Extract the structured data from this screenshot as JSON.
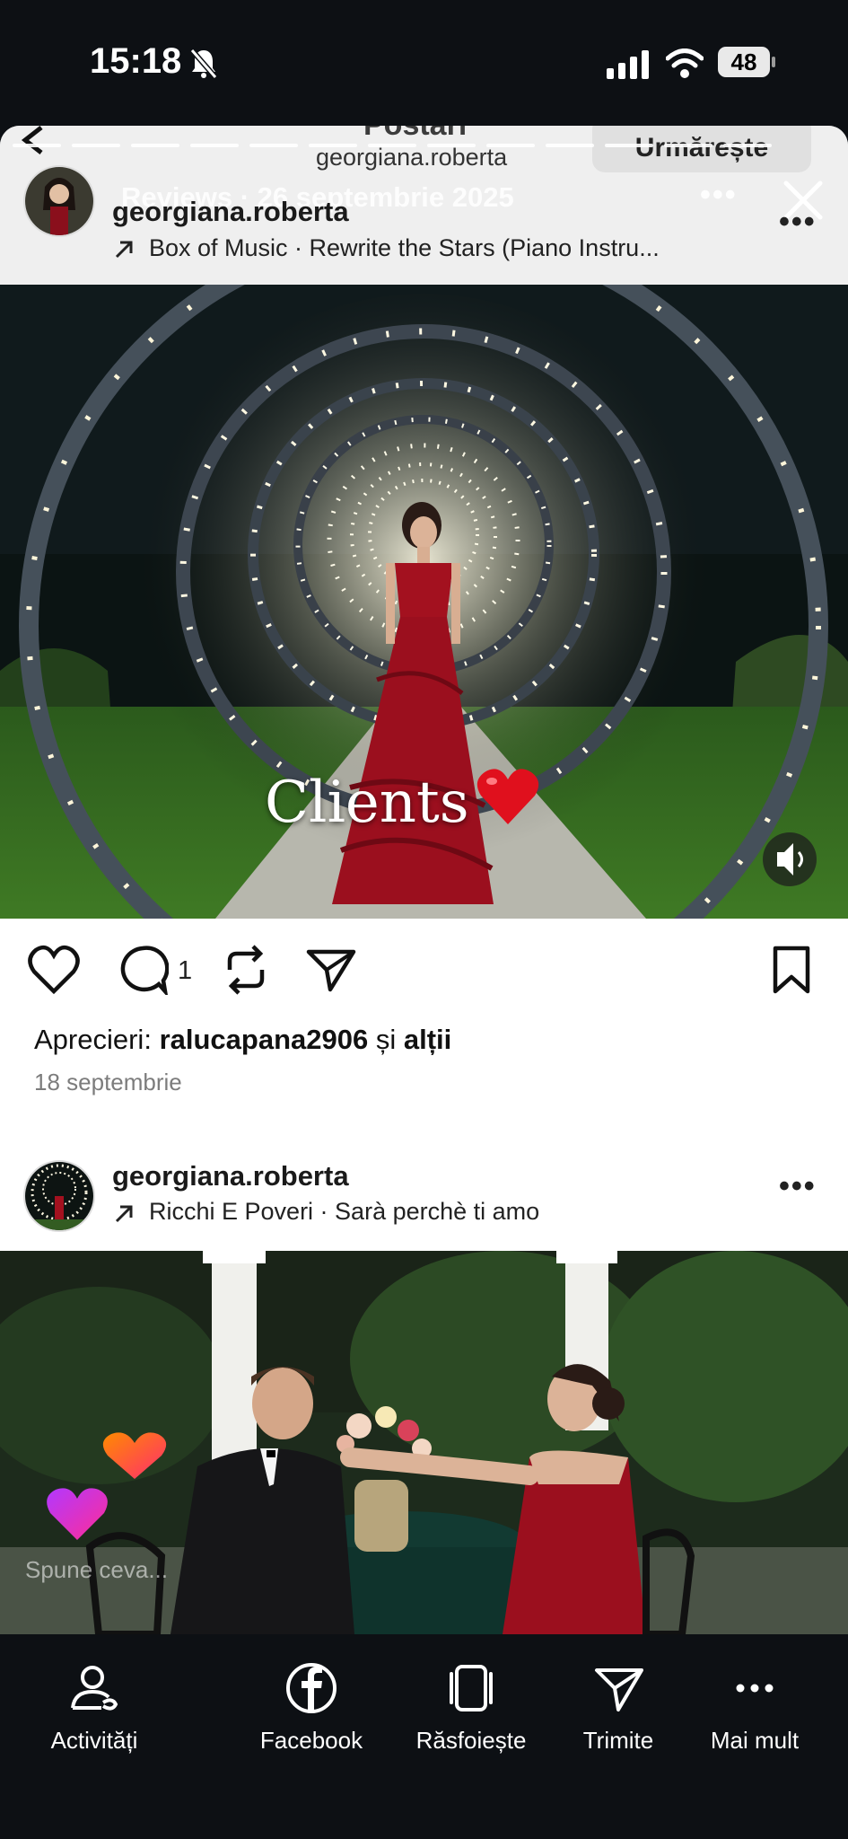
{
  "status_bar": {
    "time": "15:18",
    "battery": "48"
  },
  "sheet": {
    "ghost_title": "Postări",
    "ghost_follow": "Urmărește",
    "ghost_subtitle": "Reviews · 26 septembrie 2025",
    "header_username": "georgiana.roberta"
  },
  "post1": {
    "username": "georgiana.roberta",
    "audio": "Box of Music · Rewrite the Stars (Piano Instru...",
    "overlay_text": "Clients",
    "comment_count": "1",
    "likes_label": "Aprecieri:",
    "likes_user": "ralucapana2906",
    "likes_and": "și",
    "likes_others": "alții",
    "date": "18 septembrie"
  },
  "post2": {
    "username": "georgiana.roberta",
    "audio": "Ricchi E Poveri · Sarà perchè ti amo",
    "comment_placeholder": "Spune ceva..."
  },
  "bottom_nav": [
    {
      "label": "Activități",
      "icon": "activity-icon"
    },
    {
      "label": "Facebook",
      "icon": "facebook-icon"
    },
    {
      "label": "Răsfoiește",
      "icon": "browse-icon"
    },
    {
      "label": "Trimite",
      "icon": "send-icon"
    },
    {
      "label": "Mai mult",
      "icon": "more-icon"
    }
  ],
  "colors": {
    "background": "#0d1014",
    "dress_red": "#9b0f1e",
    "heart_red": "#e0101d"
  }
}
